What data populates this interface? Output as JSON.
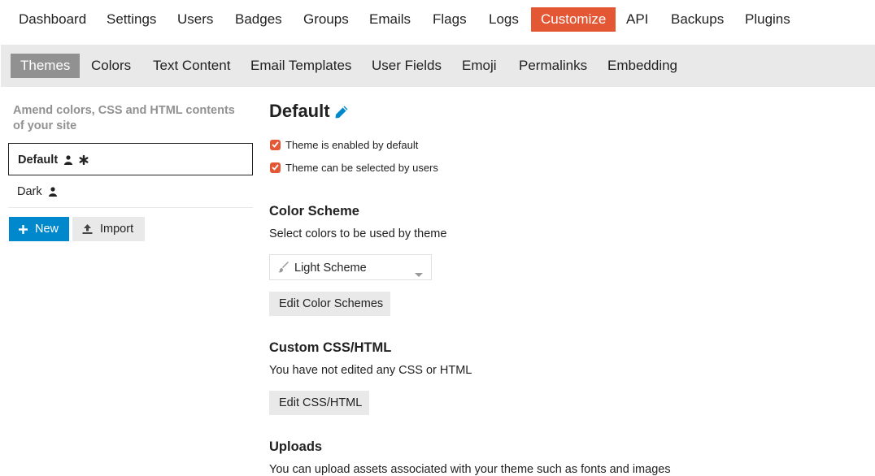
{
  "admin_nav": {
    "items": [
      "Dashboard",
      "Settings",
      "Users",
      "Badges",
      "Groups",
      "Emails",
      "Flags",
      "Logs",
      "Customize",
      "API",
      "Backups",
      "Plugins"
    ],
    "active": "Customize"
  },
  "sub_nav": {
    "items": [
      "Themes",
      "Colors",
      "Text Content",
      "Email Templates",
      "User Fields",
      "Emoji",
      "Permalinks",
      "Embedding"
    ],
    "active": "Themes"
  },
  "sidebar": {
    "description": "Amend colors, CSS and HTML contents of your site",
    "themes": [
      {
        "name": "Default",
        "icons": [
          "user-icon",
          "asterisk-icon"
        ],
        "selected": true
      },
      {
        "name": "Dark",
        "icons": [
          "user-icon"
        ],
        "selected": false
      }
    ],
    "new_label": "New",
    "import_label": "Import"
  },
  "theme": {
    "title": "Default",
    "enabled_by_default_label": "Theme is enabled by default",
    "user_selectable_label": "Theme can be selected by users"
  },
  "color_scheme": {
    "heading": "Color Scheme",
    "description": "Select colors to be used by theme",
    "selected": "Light Scheme",
    "edit_label": "Edit Color Schemes"
  },
  "custom_css": {
    "heading": "Custom CSS/HTML",
    "description": "You have not edited any CSS or HTML",
    "edit_label": "Edit CSS/HTML"
  },
  "uploads": {
    "heading": "Uploads",
    "description": "You can upload assets associated with your theme such as fonts and images"
  },
  "colors": {
    "accent": "#e45735",
    "primary_button": "#0088cc",
    "subnav_bg": "#e9e9e9",
    "subnav_active": "#919191",
    "muted_text": "#919191"
  }
}
